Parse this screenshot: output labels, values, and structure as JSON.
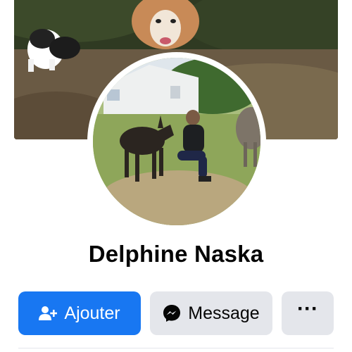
{
  "profile": {
    "name": "Delphine Naska"
  },
  "actions": {
    "add_label": "Ajouter",
    "message_label": "Message",
    "more_label": "···"
  },
  "icons": {
    "add": "add-friend-icon",
    "message": "messenger-icon",
    "more": "more-options-icon"
  },
  "colors": {
    "primary": "#1877f2",
    "secondary": "#e4e6eb",
    "text": "#050505"
  }
}
